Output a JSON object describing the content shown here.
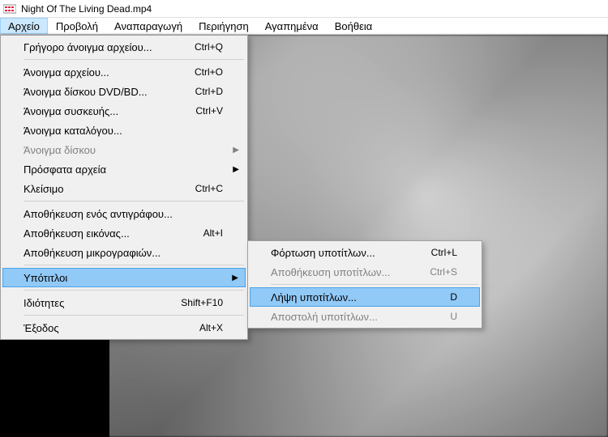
{
  "title": "Night Of The Living Dead.mp4",
  "menubar": {
    "file": "Αρχείο",
    "view": "Προβολή",
    "playback": "Αναπαραγωγή",
    "navigate": "Περιήγηση",
    "favorites": "Αγαπημένα",
    "help": "Βοήθεια"
  },
  "file_menu": {
    "quick_open": {
      "label": "Γρήγορο άνοιγμα αρχείου...",
      "shortcut": "Ctrl+Q"
    },
    "open_file": {
      "label": "Άνοιγμα αρχείου...",
      "shortcut": "Ctrl+O"
    },
    "open_disc_dvd": {
      "label": "Άνοιγμα δίσκου DVD/BD...",
      "shortcut": "Ctrl+D"
    },
    "open_device": {
      "label": "Άνοιγμα συσκευής...",
      "shortcut": "Ctrl+V"
    },
    "open_directory": {
      "label": "Άνοιγμα καταλόγου..."
    },
    "open_disc": {
      "label": "Άνοιγμα δίσκου"
    },
    "recent_files": {
      "label": "Πρόσφατα αρχεία"
    },
    "close": {
      "label": "Κλείσιμο",
      "shortcut": "Ctrl+C"
    },
    "save_copy": {
      "label": "Αποθήκευση ενός αντιγράφου..."
    },
    "save_image": {
      "label": "Αποθήκευση εικόνας...",
      "shortcut": "Alt+I"
    },
    "save_thumbnails": {
      "label": "Αποθήκευση μικρογραφιών..."
    },
    "subtitles": {
      "label": "Υπότιτλοι"
    },
    "properties": {
      "label": "Ιδιότητες",
      "shortcut": "Shift+F10"
    },
    "exit": {
      "label": "Έξοδος",
      "shortcut": "Alt+X"
    }
  },
  "subtitles_submenu": {
    "load": {
      "label": "Φόρτωση υποτίτλων...",
      "shortcut": "Ctrl+L"
    },
    "save": {
      "label": "Αποθήκευση υποτίτλων...",
      "shortcut": "Ctrl+S"
    },
    "download": {
      "label": "Λήψη υποτίτλων...",
      "shortcut": "D"
    },
    "upload": {
      "label": "Αποστολή υποτίτλων...",
      "shortcut": "U"
    }
  }
}
